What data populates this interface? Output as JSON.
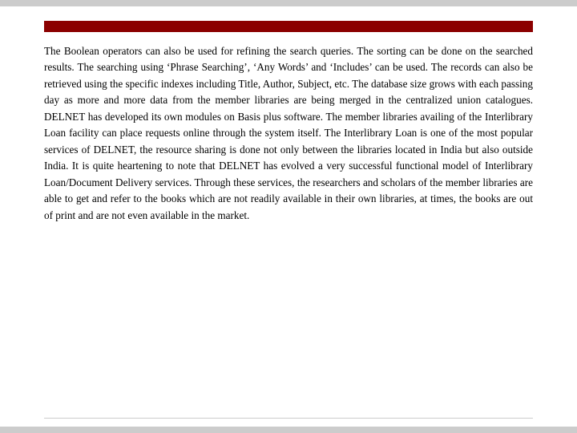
{
  "slide": {
    "top_bar_color": "#cccccc",
    "accent_bar_color": "#8b0000",
    "body_text": "The Boolean operators can also be used for refining the search queries. The sorting can be done on the searched results. The searching using ‘Phrase Searching’, ‘Any Words’ and ‘Includes’ can be used. The records can also be retrieved using the specific indexes including Title, Author, Subject, etc. The database size grows with each passing day as more and more data from the member libraries are being merged in the centralized union catalogues. DELNET has developed its own modules on Basis plus software. The member libraries availing of the Interlibrary Loan facility can place requests online through the system itself. The Interlibrary Loan is one of the most popular services of DELNET, the resource sharing is done not only between the libraries located in India but also outside India. It is quite heartening to note that DELNET has evolved a very successful functional model of Interlibrary Loan/Document Delivery services. Through these services, the researchers and scholars of the member libraries are able to get and refer to the books which are not readily available in their own libraries, at times, the books are out of print and are not even available in the market."
  }
}
